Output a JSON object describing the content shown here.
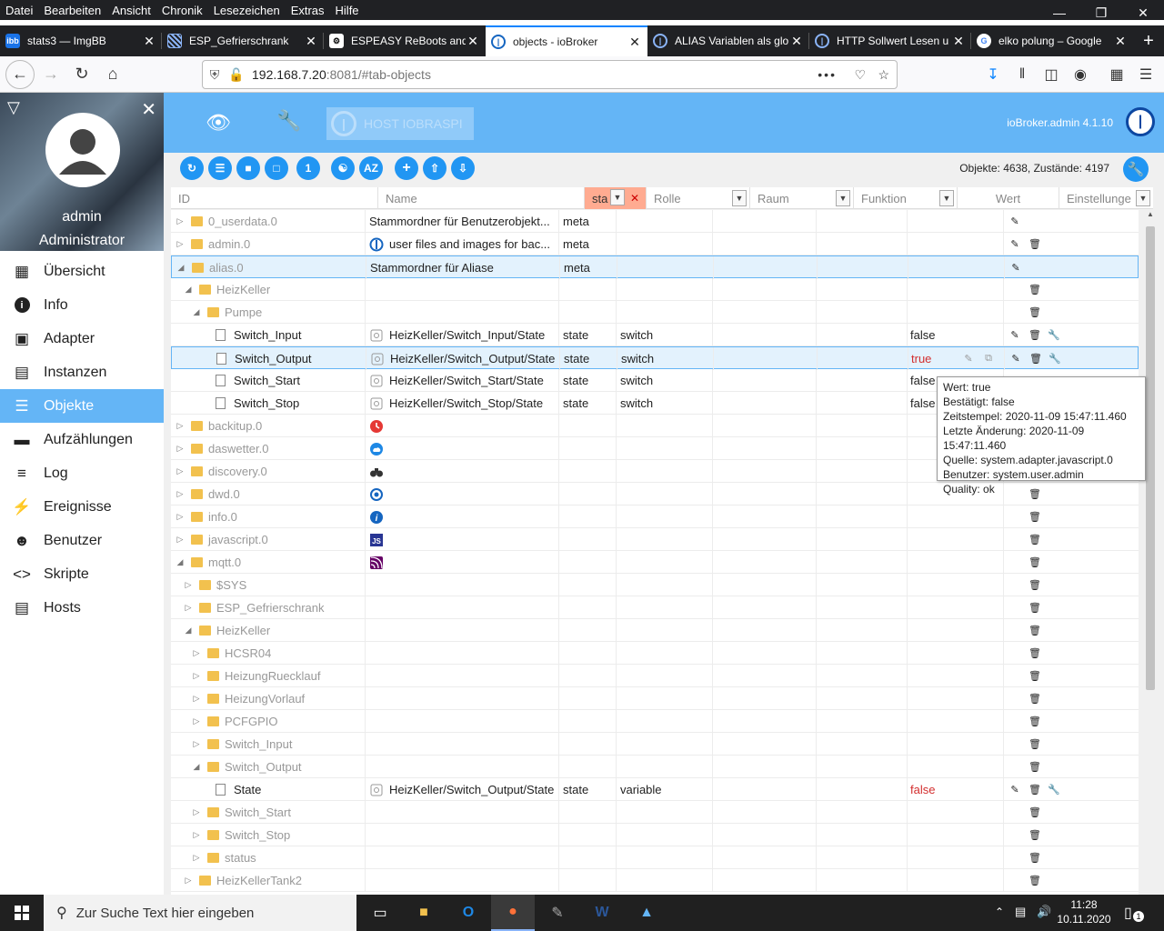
{
  "menubar": {
    "items": [
      "Datei",
      "Bearbeiten",
      "Ansicht",
      "Chronik",
      "Lesezeichen",
      "Extras",
      "Hilfe"
    ]
  },
  "tabs": [
    {
      "title": "stats3 — ImgBB",
      "icon": "ibb"
    },
    {
      "title": "ESP_Gefrierschrank",
      "icon": "esp"
    },
    {
      "title": "ESPEASY ReBoots and",
      "icon": "easy"
    },
    {
      "title": "objects - ioBroker",
      "icon": "iobroker",
      "active": true
    },
    {
      "title": "ALIAS Variablen als glo",
      "icon": "iobroker"
    },
    {
      "title": "HTTP Sollwert Lesen u",
      "icon": "iobroker"
    },
    {
      "title": "elko polung – Google",
      "icon": "google"
    }
  ],
  "url": {
    "host": "192.168.7.20",
    "rest": ":8081/#tab-objects"
  },
  "sidebar": {
    "username": "admin",
    "role": "Administrator",
    "items": [
      {
        "label": "Übersicht",
        "icon": "grid-icon"
      },
      {
        "label": "Info",
        "icon": "info-icon"
      },
      {
        "label": "Adapter",
        "icon": "store-icon"
      },
      {
        "label": "Instanzen",
        "icon": "instances-icon"
      },
      {
        "label": "Objekte",
        "icon": "list-icon",
        "active": true
      },
      {
        "label": "Aufzählungen",
        "icon": "enum-icon"
      },
      {
        "label": "Log",
        "icon": "log-icon"
      },
      {
        "label": "Ereignisse",
        "icon": "bolt-icon"
      },
      {
        "label": "Benutzer",
        "icon": "user-icon"
      },
      {
        "label": "Skripte",
        "icon": "code-icon"
      },
      {
        "label": "Hosts",
        "icon": "hosts-icon"
      }
    ]
  },
  "appbar": {
    "host_label": "HOST IOBRASPI",
    "version": "ioBroker.admin 4.1.10"
  },
  "toolbar": {
    "counts": "Objekte: 4638, Zustände: 4197"
  },
  "columns": {
    "id": "ID",
    "name": "Name",
    "type": "sta",
    "role": "Rolle",
    "room": "Raum",
    "func": "Funktion",
    "value": "Wert",
    "settings": "Einstellunge"
  },
  "rows": [
    {
      "id": "0_userdata.0",
      "name": "Stammordner für Benutzerobjekt...",
      "type": "meta",
      "role": "",
      "value": "",
      "lvl": 0,
      "exp": "right",
      "kind": "folder",
      "gray": true,
      "acts": "e"
    },
    {
      "id": "admin.0",
      "name": "user files and images for bac...",
      "type": "meta",
      "role": "",
      "value": "",
      "lvl": 0,
      "exp": "right",
      "kind": "folder",
      "gray": true,
      "nicon": "io",
      "acts": "ed"
    },
    {
      "id": "alias.0",
      "name": "Stammordner für Aliase",
      "type": "meta",
      "role": "",
      "value": "",
      "lvl": 0,
      "exp": "down",
      "kind": "folder",
      "gray": true,
      "sel": true,
      "acts": "e"
    },
    {
      "id": "HeizKeller",
      "name": "",
      "type": "",
      "role": "",
      "value": "",
      "lvl": 1,
      "exp": "down",
      "kind": "folder",
      "gray": true,
      "acts": "d"
    },
    {
      "id": "Pumpe",
      "name": "",
      "type": "",
      "role": "",
      "value": "",
      "lvl": 2,
      "exp": "down",
      "kind": "folder",
      "gray": true,
      "acts": "d"
    },
    {
      "id": "Switch_Input",
      "name": "HeizKeller/Switch_Input/State",
      "type": "state",
      "role": "switch",
      "value": "false",
      "lvl": 3,
      "exp": "",
      "kind": "file",
      "nicon": "state",
      "acts": "edw"
    },
    {
      "id": "Switch_Output",
      "name": "HeizKeller/Switch_Output/State",
      "type": "state",
      "role": "switch",
      "value": "true",
      "lvl": 3,
      "exp": "",
      "kind": "file",
      "nicon": "state",
      "red": true,
      "sel": true,
      "acts": "edw"
    },
    {
      "id": "Switch_Start",
      "name": "HeizKeller/Switch_Start/State",
      "type": "state",
      "role": "switch",
      "value": "false",
      "lvl": 3,
      "exp": "",
      "kind": "file",
      "nicon": "state",
      "acts": ""
    },
    {
      "id": "Switch_Stop",
      "name": "HeizKeller/Switch_Stop/State",
      "type": "state",
      "role": "switch",
      "value": "false",
      "lvl": 3,
      "exp": "",
      "kind": "file",
      "nicon": "state",
      "acts": ""
    },
    {
      "id": "backitup.0",
      "name": "",
      "type": "",
      "role": "",
      "value": "",
      "lvl": 0,
      "exp": "right",
      "kind": "folder",
      "gray": true,
      "nicon": "backitup",
      "acts": ""
    },
    {
      "id": "daswetter.0",
      "name": "",
      "type": "",
      "role": "",
      "value": "",
      "lvl": 0,
      "exp": "right",
      "kind": "folder",
      "gray": true,
      "nicon": "weather",
      "acts": ""
    },
    {
      "id": "discovery.0",
      "name": "",
      "type": "",
      "role": "",
      "value": "",
      "lvl": 0,
      "exp": "right",
      "kind": "folder",
      "gray": true,
      "nicon": "binoculars",
      "acts": ""
    },
    {
      "id": "dwd.0",
      "name": "",
      "type": "",
      "role": "",
      "value": "",
      "lvl": 0,
      "exp": "right",
      "kind": "folder",
      "gray": true,
      "nicon": "dwd",
      "acts": "d"
    },
    {
      "id": "info.0",
      "name": "",
      "type": "",
      "role": "",
      "value": "",
      "lvl": 0,
      "exp": "right",
      "kind": "folder",
      "gray": true,
      "nicon": "info",
      "acts": "d"
    },
    {
      "id": "javascript.0",
      "name": "",
      "type": "",
      "role": "",
      "value": "",
      "lvl": 0,
      "exp": "right",
      "kind": "folder",
      "gray": true,
      "nicon": "js",
      "acts": "d"
    },
    {
      "id": "mqtt.0",
      "name": "",
      "type": "",
      "role": "",
      "value": "",
      "lvl": 0,
      "exp": "down",
      "kind": "folder",
      "gray": true,
      "nicon": "mqtt",
      "acts": "d"
    },
    {
      "id": "$SYS",
      "name": "",
      "type": "",
      "role": "",
      "value": "",
      "lvl": 1,
      "exp": "right",
      "kind": "folder",
      "gray": true,
      "acts": "d"
    },
    {
      "id": "ESP_Gefrierschrank",
      "name": "",
      "type": "",
      "role": "",
      "value": "",
      "lvl": 1,
      "exp": "right",
      "kind": "folder",
      "gray": true,
      "acts": "d"
    },
    {
      "id": "HeizKeller",
      "name": "",
      "type": "",
      "role": "",
      "value": "",
      "lvl": 1,
      "exp": "down",
      "kind": "folder",
      "gray": true,
      "acts": "d"
    },
    {
      "id": "HCSR04",
      "name": "",
      "type": "",
      "role": "",
      "value": "",
      "lvl": 2,
      "exp": "right",
      "kind": "folder",
      "gray": true,
      "acts": "d"
    },
    {
      "id": "HeizungRuecklauf",
      "name": "",
      "type": "",
      "role": "",
      "value": "",
      "lvl": 2,
      "exp": "right",
      "kind": "folder",
      "gray": true,
      "acts": "d"
    },
    {
      "id": "HeizungVorlauf",
      "name": "",
      "type": "",
      "role": "",
      "value": "",
      "lvl": 2,
      "exp": "right",
      "kind": "folder",
      "gray": true,
      "acts": "d"
    },
    {
      "id": "PCFGPIO",
      "name": "",
      "type": "",
      "role": "",
      "value": "",
      "lvl": 2,
      "exp": "right",
      "kind": "folder",
      "gray": true,
      "acts": "d"
    },
    {
      "id": "Switch_Input",
      "name": "",
      "type": "",
      "role": "",
      "value": "",
      "lvl": 2,
      "exp": "right",
      "kind": "folder",
      "gray": true,
      "acts": "d"
    },
    {
      "id": "Switch_Output",
      "name": "",
      "type": "",
      "role": "",
      "value": "",
      "lvl": 2,
      "exp": "down",
      "kind": "folder",
      "gray": true,
      "acts": "d"
    },
    {
      "id": "State",
      "name": "HeizKeller/Switch_Output/State",
      "type": "state",
      "role": "variable",
      "value": "false",
      "lvl": 3,
      "exp": "",
      "kind": "file",
      "nicon": "state",
      "red": true,
      "acts": "edw"
    },
    {
      "id": "Switch_Start",
      "name": "",
      "type": "",
      "role": "",
      "value": "",
      "lvl": 2,
      "exp": "right",
      "kind": "folder",
      "gray": true,
      "acts": "d"
    },
    {
      "id": "Switch_Stop",
      "name": "",
      "type": "",
      "role": "",
      "value": "",
      "lvl": 2,
      "exp": "right",
      "kind": "folder",
      "gray": true,
      "acts": "d"
    },
    {
      "id": "status",
      "name": "",
      "type": "",
      "role": "",
      "value": "",
      "lvl": 2,
      "exp": "right",
      "kind": "folder",
      "gray": true,
      "acts": "d"
    },
    {
      "id": "HeizKellerTank2",
      "name": "",
      "type": "",
      "role": "",
      "value": "",
      "lvl": 1,
      "exp": "right",
      "kind": "folder",
      "gray": true,
      "acts": "d"
    }
  ],
  "tooltip": {
    "lines": [
      "Wert: true",
      "Bestätigt: false",
      "Zeitstempel: 2020-11-09 15:47:11.460",
      "Letzte Änderung: 2020-11-09 15:47:11.460",
      "Quelle: system.adapter.javascript.0",
      "Benutzer: system.user.admin",
      "Quality: ok"
    ]
  },
  "taskbar": {
    "search_placeholder": "Zur Suche Text hier eingeben",
    "time": "11:28",
    "date": "10.11.2020",
    "notif_count": "1"
  },
  "colors": {
    "accent": "#64b5f6",
    "button": "#2196f3",
    "value_red": "#d32f2f"
  }
}
